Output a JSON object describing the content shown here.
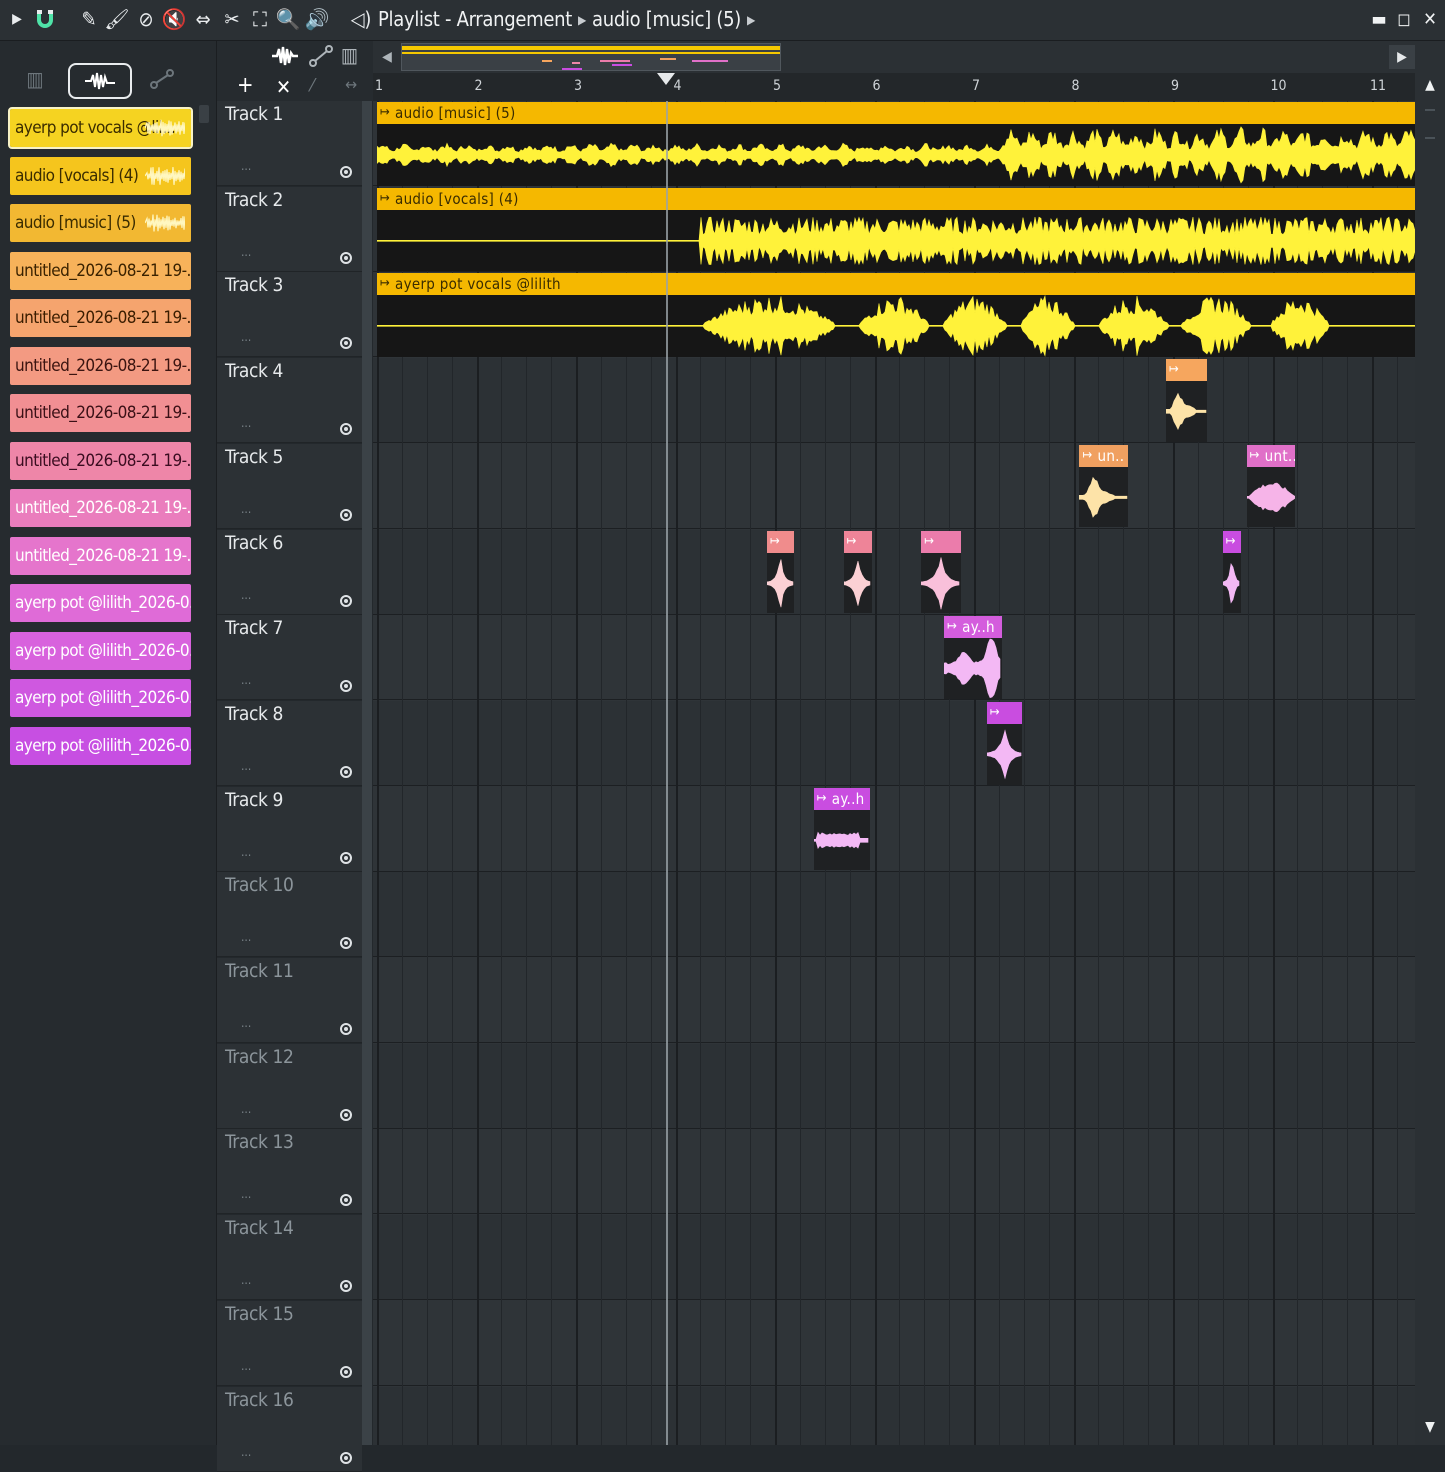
{
  "window": {
    "title": "Playlist - Arrangement",
    "breadcrumb": "audio [music] (5)"
  },
  "colors": {
    "yellow_clip": "#f5b800",
    "yellow_wave": "#fff23a",
    "cream": "#fde3a8",
    "orange": "#f2a865",
    "pink": "#f2a6b6",
    "magenta": "#e86fd0",
    "purple": "#c94de0"
  },
  "picker": {
    "modes": [
      "piano-icon",
      "audio-wave-icon",
      "automation-icon"
    ],
    "items": [
      {
        "label": "ayerp pot vocals @lil...",
        "color": "#f5d321",
        "text": "#3a2c00",
        "selected": true
      },
      {
        "label": "audio [vocals] (4)",
        "color": "#f5c51d",
        "text": "#3a2c00"
      },
      {
        "label": "audio [music] (5)",
        "color": "#f2b832",
        "text": "#3a2c00"
      },
      {
        "label": "untitled_2026-08-21 19-...",
        "color": "#f7b25a",
        "text": "#3a2200"
      },
      {
        "label": "untitled_2026-08-21 19-...",
        "color": "#f5a46e",
        "text": "#3a1d00"
      },
      {
        "label": "untitled_2026-08-21 19-...",
        "color": "#f39a82",
        "text": "#3a1410"
      },
      {
        "label": "untitled_2026-08-21 19-...",
        "color": "#f18f93",
        "text": "#3a1016"
      },
      {
        "label": "untitled_2026-08-21 19-...",
        "color": "#ee86a8",
        "text": "#3a0c20"
      },
      {
        "label": "untitled_2026-08-21 19-...",
        "color": "#ea7dbd",
        "text": "#ffffff"
      },
      {
        "label": "untitled_2026-08-21 19-...",
        "color": "#e575cc",
        "text": "#ffffff"
      },
      {
        "label": "ayerp pot @lilith_2026-0...",
        "color": "#df6bd7",
        "text": "#ffffff"
      },
      {
        "label": "ayerp pot @lilith_2026-0...",
        "color": "#d862dd",
        "text": "#ffffff"
      },
      {
        "label": "ayerp pot @lilith_2026-0...",
        "color": "#cf58e0",
        "text": "#ffffff"
      },
      {
        "label": "ayerp pot @lilith_2026-0...",
        "color": "#c74fe2",
        "text": "#ffffff"
      }
    ]
  },
  "ruler": {
    "bars": [
      "1",
      "2",
      "3",
      "4",
      "5",
      "6",
      "7",
      "8",
      "9",
      "10",
      "11"
    ]
  },
  "tracks": [
    {
      "name": "Track 1",
      "dots": "..."
    },
    {
      "name": "Track 2",
      "dots": "..."
    },
    {
      "name": "Track 3",
      "dots": "..."
    },
    {
      "name": "Track 4",
      "dots": "..."
    },
    {
      "name": "Track 5",
      "dots": "..."
    },
    {
      "name": "Track 6",
      "dots": "..."
    },
    {
      "name": "Track 7",
      "dots": "..."
    },
    {
      "name": "Track 8",
      "dots": "..."
    },
    {
      "name": "Track 9",
      "dots": "..."
    },
    {
      "name": "Track 10",
      "dots": "...",
      "empty": true
    },
    {
      "name": "Track 11",
      "dots": "...",
      "empty": true
    },
    {
      "name": "Track 12",
      "dots": "...",
      "empty": true
    },
    {
      "name": "Track 13",
      "dots": "...",
      "empty": true
    },
    {
      "name": "Track 14",
      "dots": "...",
      "empty": true
    },
    {
      "name": "Track 15",
      "dots": "...",
      "empty": true
    },
    {
      "name": "Track 16",
      "dots": "...",
      "empty": true
    }
  ],
  "clips": [
    {
      "title": "audio [music] (5)",
      "track": 1,
      "start_bar": 1.0,
      "end_bar": 11.45,
      "color": "#f5b800",
      "wave": "#fff23a",
      "kind": "music"
    },
    {
      "title": "audio [vocals] (4)",
      "track": 2,
      "start_bar": 1.0,
      "end_bar": 11.45,
      "color": "#f5b800",
      "wave": "#fff23a",
      "kind": "vocals"
    },
    {
      "title": "ayerp pot vocals @lilith",
      "track": 3,
      "start_bar": 1.0,
      "end_bar": 11.45,
      "color": "#f5b800",
      "wave": "#fff23a",
      "kind": "phrases"
    },
    {
      "title": "",
      "track": 4,
      "start_bar": 8.93,
      "end_bar": 9.34,
      "color": "#f6a65e",
      "wave": "#fde3a8",
      "kind": "hit"
    },
    {
      "title": "un..",
      "track": 5,
      "start_bar": 8.06,
      "end_bar": 8.55,
      "color": "#f0a060",
      "wave": "#fde3a8",
      "kind": "hit"
    },
    {
      "title": "unt..",
      "track": 5,
      "start_bar": 9.74,
      "end_bar": 10.23,
      "color": "#e070c8",
      "wave": "#f6b4e8",
      "kind": "blob"
    },
    {
      "title": "",
      "track": 6,
      "start_bar": 4.92,
      "end_bar": 5.19,
      "color": "#f08c8c",
      "wave": "#fbd0d4",
      "kind": "spike"
    },
    {
      "title": "",
      "track": 6,
      "start_bar": 5.69,
      "end_bar": 5.97,
      "color": "#ee8498",
      "wave": "#fbd0d4",
      "kind": "spike"
    },
    {
      "title": "",
      "track": 6,
      "start_bar": 6.47,
      "end_bar": 6.87,
      "color": "#eb7cab",
      "wave": "#f9c0da",
      "kind": "spike"
    },
    {
      "title": "",
      "track": 6,
      "start_bar": 9.5,
      "end_bar": 9.68,
      "color": "#c94de0",
      "wave": "#f3b8f4",
      "kind": "spike"
    },
    {
      "title": "ay..h",
      "track": 7,
      "start_bar": 6.7,
      "end_bar": 7.28,
      "color": "#d45ddd",
      "wave": "#f3b8f4",
      "kind": "double"
    },
    {
      "title": "",
      "track": 8,
      "start_bar": 7.13,
      "end_bar": 7.48,
      "color": "#c94de0",
      "wave": "#f3b8f4",
      "kind": "spike"
    },
    {
      "title": "ay..h",
      "track": 9,
      "start_bar": 5.39,
      "end_bar": 5.95,
      "color": "#c94de0",
      "wave": "#f3b8f4",
      "kind": "flat"
    }
  ],
  "playhead_bar": 3.9
}
